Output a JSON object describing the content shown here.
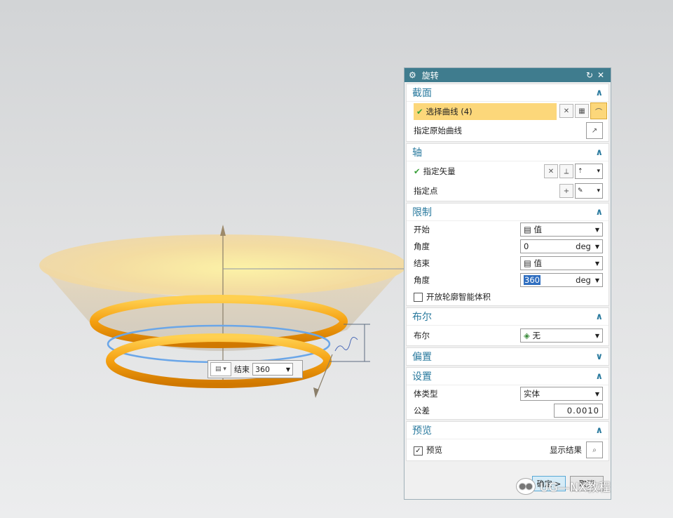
{
  "floating_input": {
    "label": "结束",
    "value": "360"
  },
  "dialog": {
    "title": "旋转",
    "section": {
      "header": "截面",
      "select_curve": "选择曲线 (4)",
      "specify_origin_curve": "指定原始曲线"
    },
    "axis": {
      "header": "轴",
      "specify_vector": "指定矢量",
      "specify_point": "指定点"
    },
    "limits": {
      "header": "限制",
      "start_label": "开始",
      "start_value": "值",
      "start_angle_label": "角度",
      "start_angle": "0",
      "start_unit": "deg",
      "end_label": "结束",
      "end_value": "值",
      "end_angle_label": "角度",
      "end_angle": "360",
      "end_unit": "deg",
      "open_profile": "开放轮廓智能体积"
    },
    "boolean": {
      "header": "布尔",
      "label": "布尔",
      "value": "无"
    },
    "offset": {
      "header": "偏置"
    },
    "settings": {
      "header": "设置",
      "body_type_label": "体类型",
      "body_type": "实体",
      "tolerance_label": "公差",
      "tolerance": "0.0010"
    },
    "preview": {
      "header": "预览",
      "preview_label": "预览",
      "show_result": "显示结果"
    },
    "ok": "确定",
    "cancel": "取消"
  },
  "watermark": "UG—NX教程",
  "colors": {
    "title_bar": "#3f7c8e",
    "header_text": "#2a7a9e",
    "selection": "#fcd77a",
    "ring": "#f0a020"
  }
}
